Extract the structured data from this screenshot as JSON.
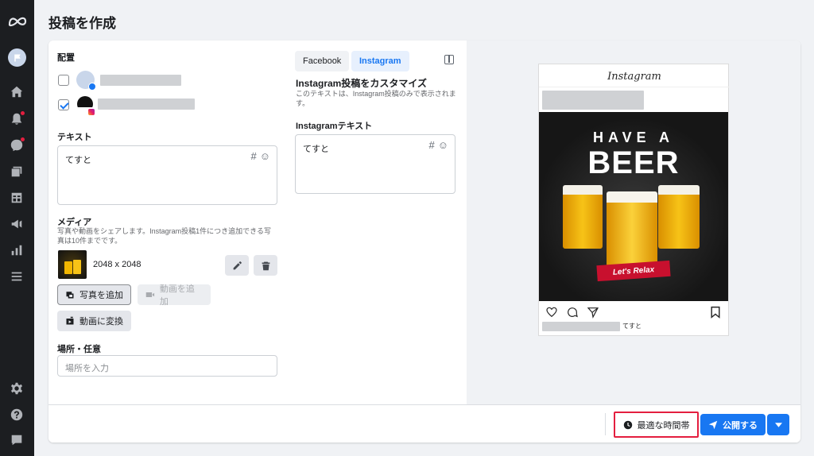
{
  "page": {
    "title": "投稿を作成"
  },
  "sidebar": {
    "items": [
      "meta-logo",
      "account-avatar",
      "home-icon",
      "notifications-icon",
      "messages-icon",
      "content-icon",
      "planner-icon",
      "ads-icon",
      "insights-icon",
      "menu-icon",
      "settings-icon",
      "help-icon",
      "feedback-icon"
    ]
  },
  "left": {
    "placement_label": "配置",
    "text_label": "テキスト",
    "text_value": "てすと",
    "media_label": "メディア",
    "media_help_line1": "写真や動画をシェアします。Instagram投稿1件につき追加できる写",
    "media_help_line2": "真は10件までです。",
    "media_size": "2048 x 2048",
    "add_photo": "写真を追加",
    "add_video": "動画を追加",
    "convert_video": "動画に変換",
    "location_label": "場所・任意",
    "location_placeholder": "場所を入力"
  },
  "middle": {
    "tab_facebook": "Facebook",
    "tab_instagram": "Instagram",
    "customize_title": "Instagram投稿をカスタマイズ",
    "customize_help_line1": "このテキストは、Instagram投稿のみで表示されま",
    "customize_help_line2": "す。",
    "ig_text_label": "Instagramテキスト",
    "ig_text_value": "てすと"
  },
  "preview": {
    "logo": "Instagram",
    "caption": "てすと",
    "image_text_top": "HAVE A",
    "image_text_main": "BEER",
    "image_text_ribbon": "Let's Relax"
  },
  "footer": {
    "schedule_label": "最適な時間帯",
    "publish_label": "公開する"
  },
  "colors": {
    "accent": "#1877f2",
    "highlight": "#e41e3f",
    "sidebar": "#1c1e21"
  }
}
